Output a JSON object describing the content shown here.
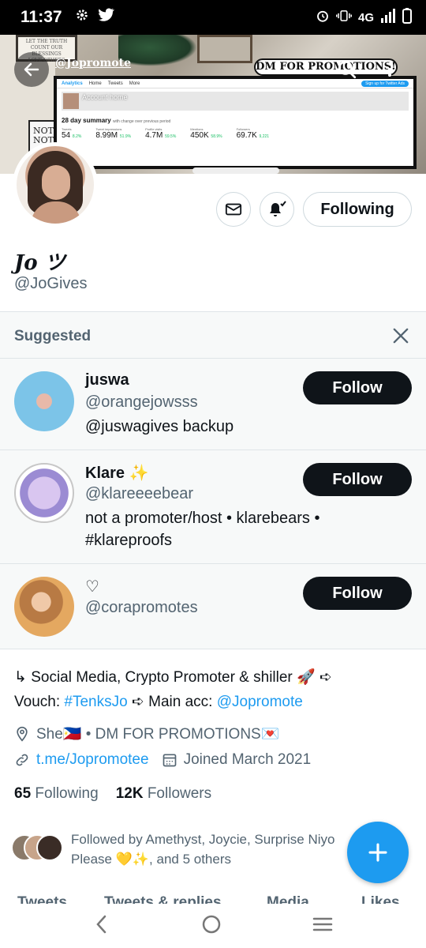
{
  "status_bar": {
    "time": "11:37",
    "network": "4G"
  },
  "banner": {
    "handle_overlay": "@Jopromote",
    "dm_label": "DM FOR PROMOTIONS!",
    "sign_text": "NOT ST NOT IN",
    "analytics": {
      "tab_analytics": "Analytics",
      "tab_home": "Home",
      "tab_tweets": "Tweets",
      "tab_more": "More",
      "signup": "Sign up for Twitter Ads",
      "account_home": "Account home",
      "summary_title": "28 day summary",
      "summary_sub": "with change over previous period",
      "stats": [
        {
          "label": "Tweets",
          "value": "54",
          "change": "8.2%"
        },
        {
          "label": "Tweet impressions",
          "value": "8.99M",
          "change": "51.9%"
        },
        {
          "label": "Profile visits",
          "value": "4.7M",
          "change": "59.5%"
        },
        {
          "label": "Mentions",
          "value": "450K",
          "change": "58.9%"
        },
        {
          "label": "Followers",
          "value": "69.7K",
          "change": "9,221"
        }
      ]
    }
  },
  "profile": {
    "display_name": "Jo ツ",
    "handle": "@JoGives",
    "following_button": "Following"
  },
  "suggested": {
    "title": "Suggested",
    "items": [
      {
        "name": "juswa",
        "handle": "@orangejowsss",
        "bio": "@juswagives backup",
        "button": "Follow"
      },
      {
        "name": "Klare ✨",
        "handle": "@klareeeebear",
        "bio": "not a promoter/host • klarebears • #klareproofs",
        "button": "Follow"
      },
      {
        "name": "♡",
        "handle": "@corapromotes",
        "bio": "",
        "button": "Follow"
      }
    ]
  },
  "bio": {
    "line1": "↳ Social Media, Crypto Promoter & shiller 🚀 ➪",
    "vouch_label": "Vouch: ",
    "vouch_tag": "#TenksJo",
    "main_label": " ➪ Main acc: ",
    "main_acc": "@Jopromote"
  },
  "meta": {
    "location": "She🇵🇭 •  DM FOR PROMOTIONS💌",
    "link": "t.me/Jopromotee",
    "joined": "Joined March 2021"
  },
  "counts": {
    "following_num": "65",
    "following_label": "Following",
    "followers_num": "12K",
    "followers_label": "Followers"
  },
  "followed_by": {
    "line1": "Followed by Amethyst, Joycie, Surprise Niyo",
    "line2": "Please 💛✨, and 5 others"
  },
  "tabs": [
    "Tweets",
    "Tweets & replies",
    "Media",
    "Likes"
  ],
  "colors": {
    "accent": "#1d9bf0",
    "text": "#0f1419",
    "muted": "#536471"
  }
}
